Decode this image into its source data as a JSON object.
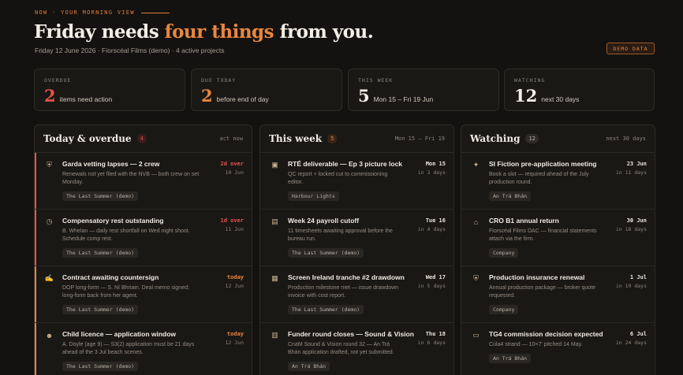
{
  "header": {
    "eyebrow": "NOW · YOUR MORNING VIEW",
    "title_pre": "Friday needs ",
    "title_accent": "four things",
    "title_post": " from you.",
    "subline": "Friday 12 June 2026 · Fiorscéal Films (demo) · 4 active projects",
    "badge": "DEMO DATA"
  },
  "colors": {
    "accent": "#e8873f",
    "red": "#e5534b",
    "muted": "#8c857b"
  },
  "stats": [
    {
      "label": "OVERDUE",
      "value": "2",
      "text": "items need action",
      "color": "#e5534b"
    },
    {
      "label": "DUE TODAY",
      "value": "2",
      "text": "before end of day",
      "color": "#e8873f"
    },
    {
      "label": "THIS WEEK",
      "value": "5",
      "text": "Mon 15 – Fri 19 Jun",
      "color": "#f3eee6"
    },
    {
      "label": "WATCHING",
      "value": "12",
      "text": "next 30 days",
      "color": "#f3eee6"
    }
  ],
  "columns": [
    {
      "title": "Today & overdue",
      "count": "4",
      "note": "act now",
      "count_bg": "#3a1c1a",
      "count_fg": "#e5534b",
      "items": [
        {
          "icon": "shield-icon",
          "glyph": "⛨",
          "title": "Garda vetting lapses — 2 crew",
          "desc": "Renewals not yet filed with the NVB — both crew on set Monday.",
          "tag": "The Last Summer (demo)",
          "due1": "2d over",
          "due2": "10 Jun",
          "due_color": "#e5534b",
          "bar": "#e5534b"
        },
        {
          "icon": "clock-icon",
          "glyph": "◷",
          "title": "Compensatory rest outstanding",
          "desc": "B. Whelan — daily rest shortfall on Wed night shoot. Schedule comp rest.",
          "tag": "The Last Summer (demo)",
          "due1": "1d over",
          "due2": "11 Jun",
          "due_color": "#e5534b",
          "bar": "#e5534b"
        },
        {
          "icon": "handshake-icon",
          "glyph": "✍",
          "title": "Contract awaiting countersign",
          "desc": "DOP long-form — S. Ní Bhriain. Deal memo signed; long-form back from her agent.",
          "tag": "The Last Summer (demo)",
          "due1": "today",
          "due2": "12 Jun",
          "due_color": "#e8873f",
          "bar": "#e8873f"
        },
        {
          "icon": "child-icon",
          "glyph": "☻",
          "title": "Child licence — application window",
          "desc": "A. Doyle (age 9) — S3(2) application must be 21 days ahead of the 3 Jul beach scenes.",
          "tag": "The Last Summer (demo)",
          "due1": "today",
          "due2": "12 Jun",
          "due_color": "#e8873f",
          "bar": "#e8873f"
        }
      ]
    },
    {
      "title": "This week",
      "count": "5",
      "note": "Mon 15 – Fri 19",
      "count_bg": "#3a2516",
      "count_fg": "#e8873f",
      "items": [
        {
          "icon": "package-icon",
          "glyph": "▣",
          "title": "RTÉ deliverable — Ep 3 picture lock",
          "desc": "QC report + locked cut to commissioning editor.",
          "tag": "Harbour Lights",
          "due1": "Mon 15",
          "due2": "in 3 days",
          "due_color": "#ece6dc",
          "bar": ""
        },
        {
          "icon": "document-icon",
          "glyph": "▤",
          "title": "Week 24 payroll cutoff",
          "desc": "11 timesheets awaiting approval before the bureau run.",
          "tag": "The Last Summer (demo)",
          "due1": "Tue 16",
          "due2": "in 4 days",
          "due_color": "#ece6dc",
          "bar": ""
        },
        {
          "icon": "banknote-icon",
          "glyph": "▦",
          "title": "Screen Ireland tranche #2 drawdown",
          "desc": "Production milestone met — issue drawdown invoice with cost report.",
          "tag": "The Last Summer (demo)",
          "due1": "Wed 17",
          "due2": "in 5 days",
          "due_color": "#ece6dc",
          "bar": ""
        },
        {
          "icon": "calendar-icon",
          "glyph": "▥",
          "title": "Funder round closes — Sound & Vision",
          "desc": "CnaM Sound & Vision round 32 — An Trá Bhán application drafted, not yet submitted.",
          "tag": "An Trá Bhán",
          "due1": "Thu 18",
          "due2": "in 6 days",
          "due_color": "#ece6dc",
          "bar": ""
        }
      ]
    },
    {
      "title": "Watching",
      "count": "12",
      "note": "next 30 days",
      "count_bg": "#2e2b27",
      "count_fg": "#b7afa4",
      "items": [
        {
          "icon": "megaphone-icon",
          "glyph": "✦",
          "title": "SI Fiction pre-application meeting",
          "desc": "Book a slot — required ahead of the July production round.",
          "tag": "An Trá Bhán",
          "due1": "23 Jun",
          "due2": "in 11 days",
          "due_color": "#ece6dc",
          "bar": ""
        },
        {
          "icon": "bank-icon",
          "glyph": "⌂",
          "title": "CRO B1 annual return",
          "desc": "Fiorscéal Films DAC — financial statements attach via the firm.",
          "tag": "Company",
          "due1": "30 Jun",
          "due2": "in 18 days",
          "due_color": "#ece6dc",
          "bar": ""
        },
        {
          "icon": "shield-icon",
          "glyph": "⛨",
          "title": "Production insurance renewal",
          "desc": "Annual production package — broker quote requested.",
          "tag": "Company",
          "due1": "1 Jul",
          "due2": "in 19 days",
          "due_color": "#ece6dc",
          "bar": ""
        },
        {
          "icon": "tv-icon",
          "glyph": "▭",
          "title": "TG4 commission decision expected",
          "desc": "Cúla4 strand — 10×7' pitched 14 May.",
          "tag": "An Trá Bhán",
          "due1": "6 Jul",
          "due2": "in 24 days",
          "due_color": "#ece6dc",
          "bar": ""
        }
      ]
    }
  ]
}
